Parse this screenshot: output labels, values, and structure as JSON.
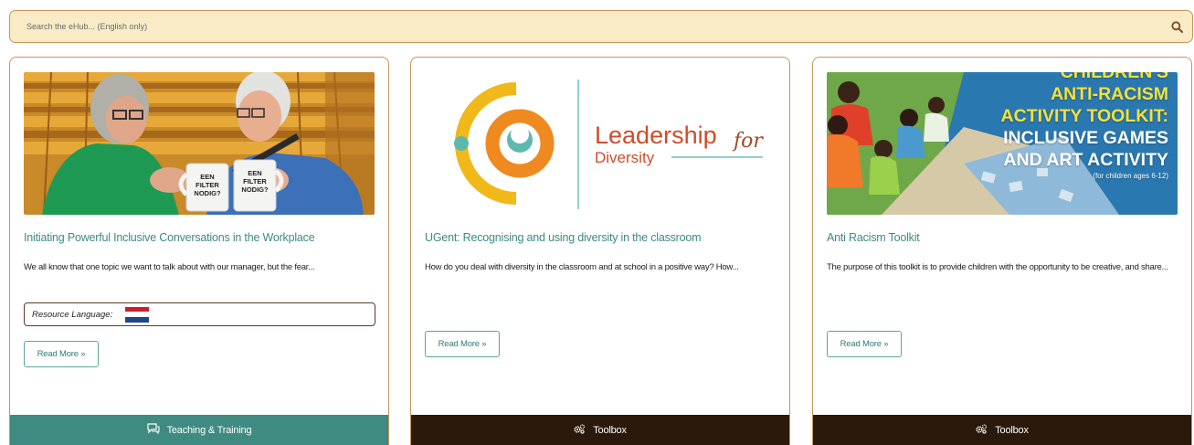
{
  "search": {
    "placeholder": "Search the eHub... (English only)"
  },
  "cards": [
    {
      "title": "Initiating Powerful Inclusive Conversations in the Workplace",
      "description": "We all know that one topic we want to talk about with our manager, but the fear...",
      "resource_language_label": "Resource Language:",
      "read_more": "Read More »",
      "category": "Teaching & Training",
      "category_icon": "chat-icon",
      "mug_text": [
        "EEN",
        "FILTER",
        "NODIG?"
      ]
    },
    {
      "title": "UGent: Recognising and using diversity in the classroom",
      "description": "How do you deal with diversity in the classroom and at school in a positive way? How...",
      "read_more": "Read More »",
      "category": "Toolbox",
      "category_icon": "gears-icon",
      "logo": {
        "line1": "Leadership",
        "line2": "Diversity",
        "script": "for"
      }
    },
    {
      "title": "Anti Racism Toolkit",
      "description": "The purpose of this toolkit is to provide children with the opportunity to be creative, and share...",
      "read_more": "Read More »",
      "category": "Toolbox",
      "category_icon": "gears-icon",
      "overlay": {
        "line0": "CHILDREN'S",
        "line1": "ANTI-RACISM",
        "line2": "ACTIVITY TOOLKIT:",
        "line3": "INCLUSIVE GAMES",
        "line4": "AND ART ACTIVITY",
        "line5": "(for children ages 6-12)"
      }
    }
  ],
  "colors": {
    "search_bg": "#f8ebc6",
    "border": "#c8955a",
    "teal": "#3f8a81",
    "dark_brown": "#2b1a0b",
    "title_teal": "#3d8a82"
  }
}
